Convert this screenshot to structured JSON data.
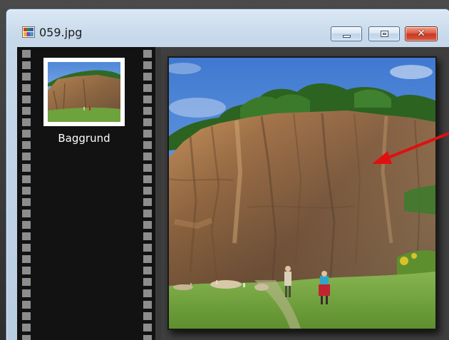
{
  "window": {
    "title": "059.jpg",
    "icon": "image-file-icon",
    "controls": {
      "minimize_icon": "minimize-icon",
      "maximize_icon": "maximize-icon",
      "close_icon": "close-icon",
      "close_glyph": "✕"
    }
  },
  "filmstrip": {
    "items": [
      {
        "label": "Baggrund",
        "thumbnail": "cliff-photo-thumbnail"
      }
    ]
  },
  "preview": {
    "image": "cliff-photo-preview"
  },
  "annotation": {
    "icon": "red-arrow-icon",
    "color": "#e01010"
  },
  "colors": {
    "close_button": "#c43a22",
    "filmstrip_bg": "#121212",
    "titlebar": "#c6d8ea"
  }
}
